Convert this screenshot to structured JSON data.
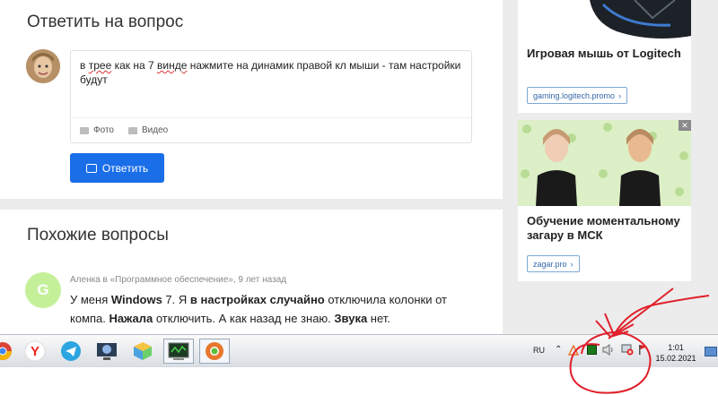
{
  "answer": {
    "heading": "Ответить на вопрос",
    "reply_part1": "в ",
    "reply_misspelled1": "трее",
    "reply_part2": " как на 7 ",
    "reply_misspelled2": "винде",
    "reply_part3": " нажмите на динамик правой кл мыши - там настройки будут",
    "photo_label": "Фото",
    "video_label": "Видео",
    "submit_label": "Ответить"
  },
  "similar": {
    "heading": "Похожие вопросы",
    "item": {
      "avatar_letter": "G",
      "meta": "Аленка в «Программное обеспечение», 9 лет назад",
      "t1": "У меня ",
      "b1": "Windows",
      "t2": " 7. Я ",
      "b2": "в настройках случайно",
      "t3": " отключила колонки от компа. ",
      "b3": "Нажала",
      "t4": " отключить. А как назад не знаю. ",
      "b4": "Звука",
      "t5": " нет."
    }
  },
  "ads": [
    {
      "title": "Игровая мышь от Logitech",
      "link": "gaming.logitech.promo"
    },
    {
      "title": "Обучение моментальному загару в МСК",
      "link": "zagar.pro"
    }
  ],
  "taskbar": {
    "lang": "RU",
    "time": "1:01",
    "date": "15.02.2021",
    "apps": [
      "chrome-icon",
      "yandex-icon",
      "telegram-icon",
      "monitor-icon",
      "cube-icon",
      "terminal-icon",
      "chrome-icon"
    ]
  },
  "colors": {
    "accent": "#1a6ee8",
    "annotation": "#e0202a"
  }
}
